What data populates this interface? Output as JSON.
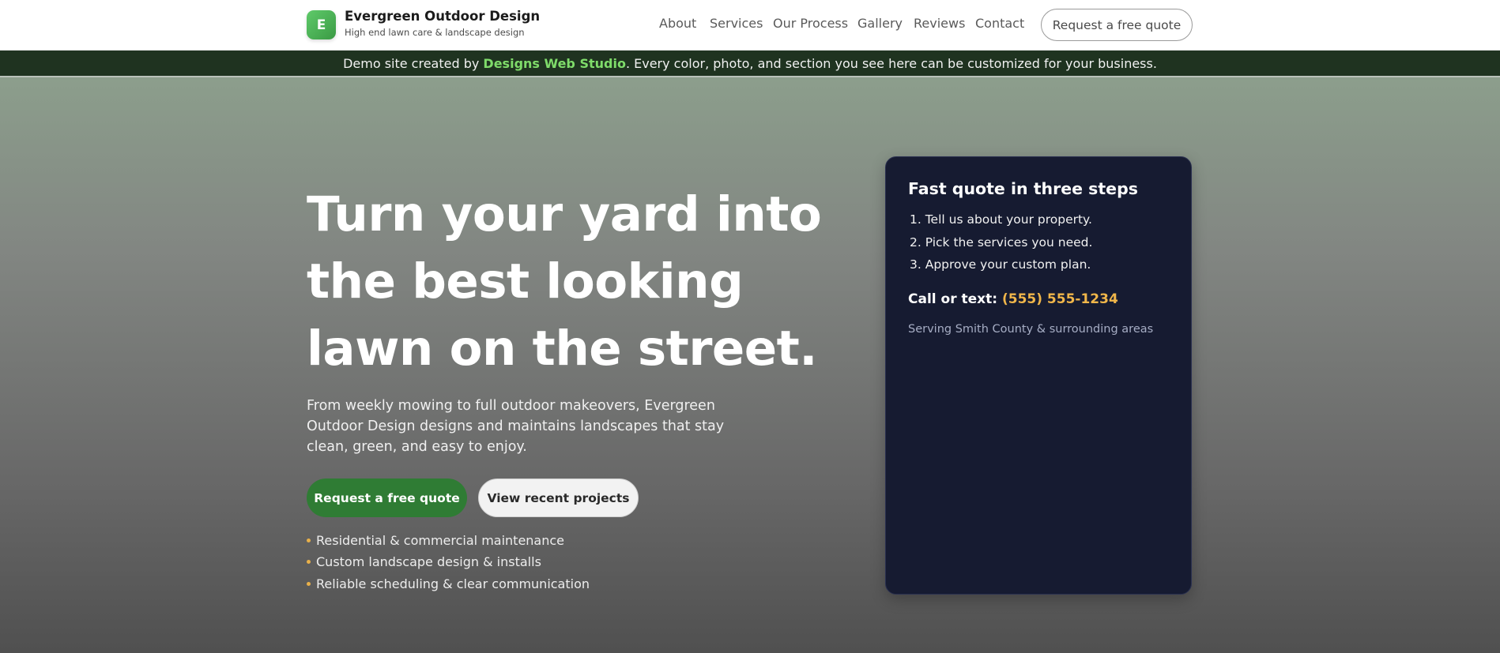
{
  "brand": {
    "badge_letter": "E",
    "name": "Evergreen Outdoor Design",
    "tagline": "High end lawn care & landscape design"
  },
  "nav": {
    "items": [
      "About",
      "Services",
      "Our Process",
      "Gallery",
      "Reviews",
      "Contact"
    ],
    "cta_label": "Request a free quote"
  },
  "banner": {
    "prefix": "Demo site created by ",
    "studio": "Designs Web Studio",
    "suffix": ". Every color, photo, and section you see here can be customized for your business."
  },
  "hero": {
    "title": "Turn your yard into the best looking lawn on the street.",
    "description": "From weekly mowing to full outdoor makeovers, Evergreen Outdoor Design designs and maintains landscapes that stay clean, green, and easy to enjoy.",
    "primary_button": "Request a free quote",
    "secondary_button": "View recent projects",
    "features": [
      "Residential & commercial maintenance",
      "Custom landscape design & installs",
      "Reliable scheduling & clear communication"
    ]
  },
  "quote_card": {
    "title": "Fast quote in three steps",
    "steps": [
      "1. Tell us about your property.",
      "2. Pick the services you need.",
      "3. Approve your custom plan."
    ],
    "call_label": "Call or text: ",
    "phone": "(555) 555-1234",
    "service_area": "Serving Smith County & surrounding areas"
  },
  "colors": {
    "primary_green": "#2f7c34",
    "banner_bg": "#1f3320",
    "studio_accent": "#7fdc6a",
    "card_bg": "#161b31",
    "phone_accent": "#f0b64a",
    "bullet_accent": "#e8b04a"
  }
}
